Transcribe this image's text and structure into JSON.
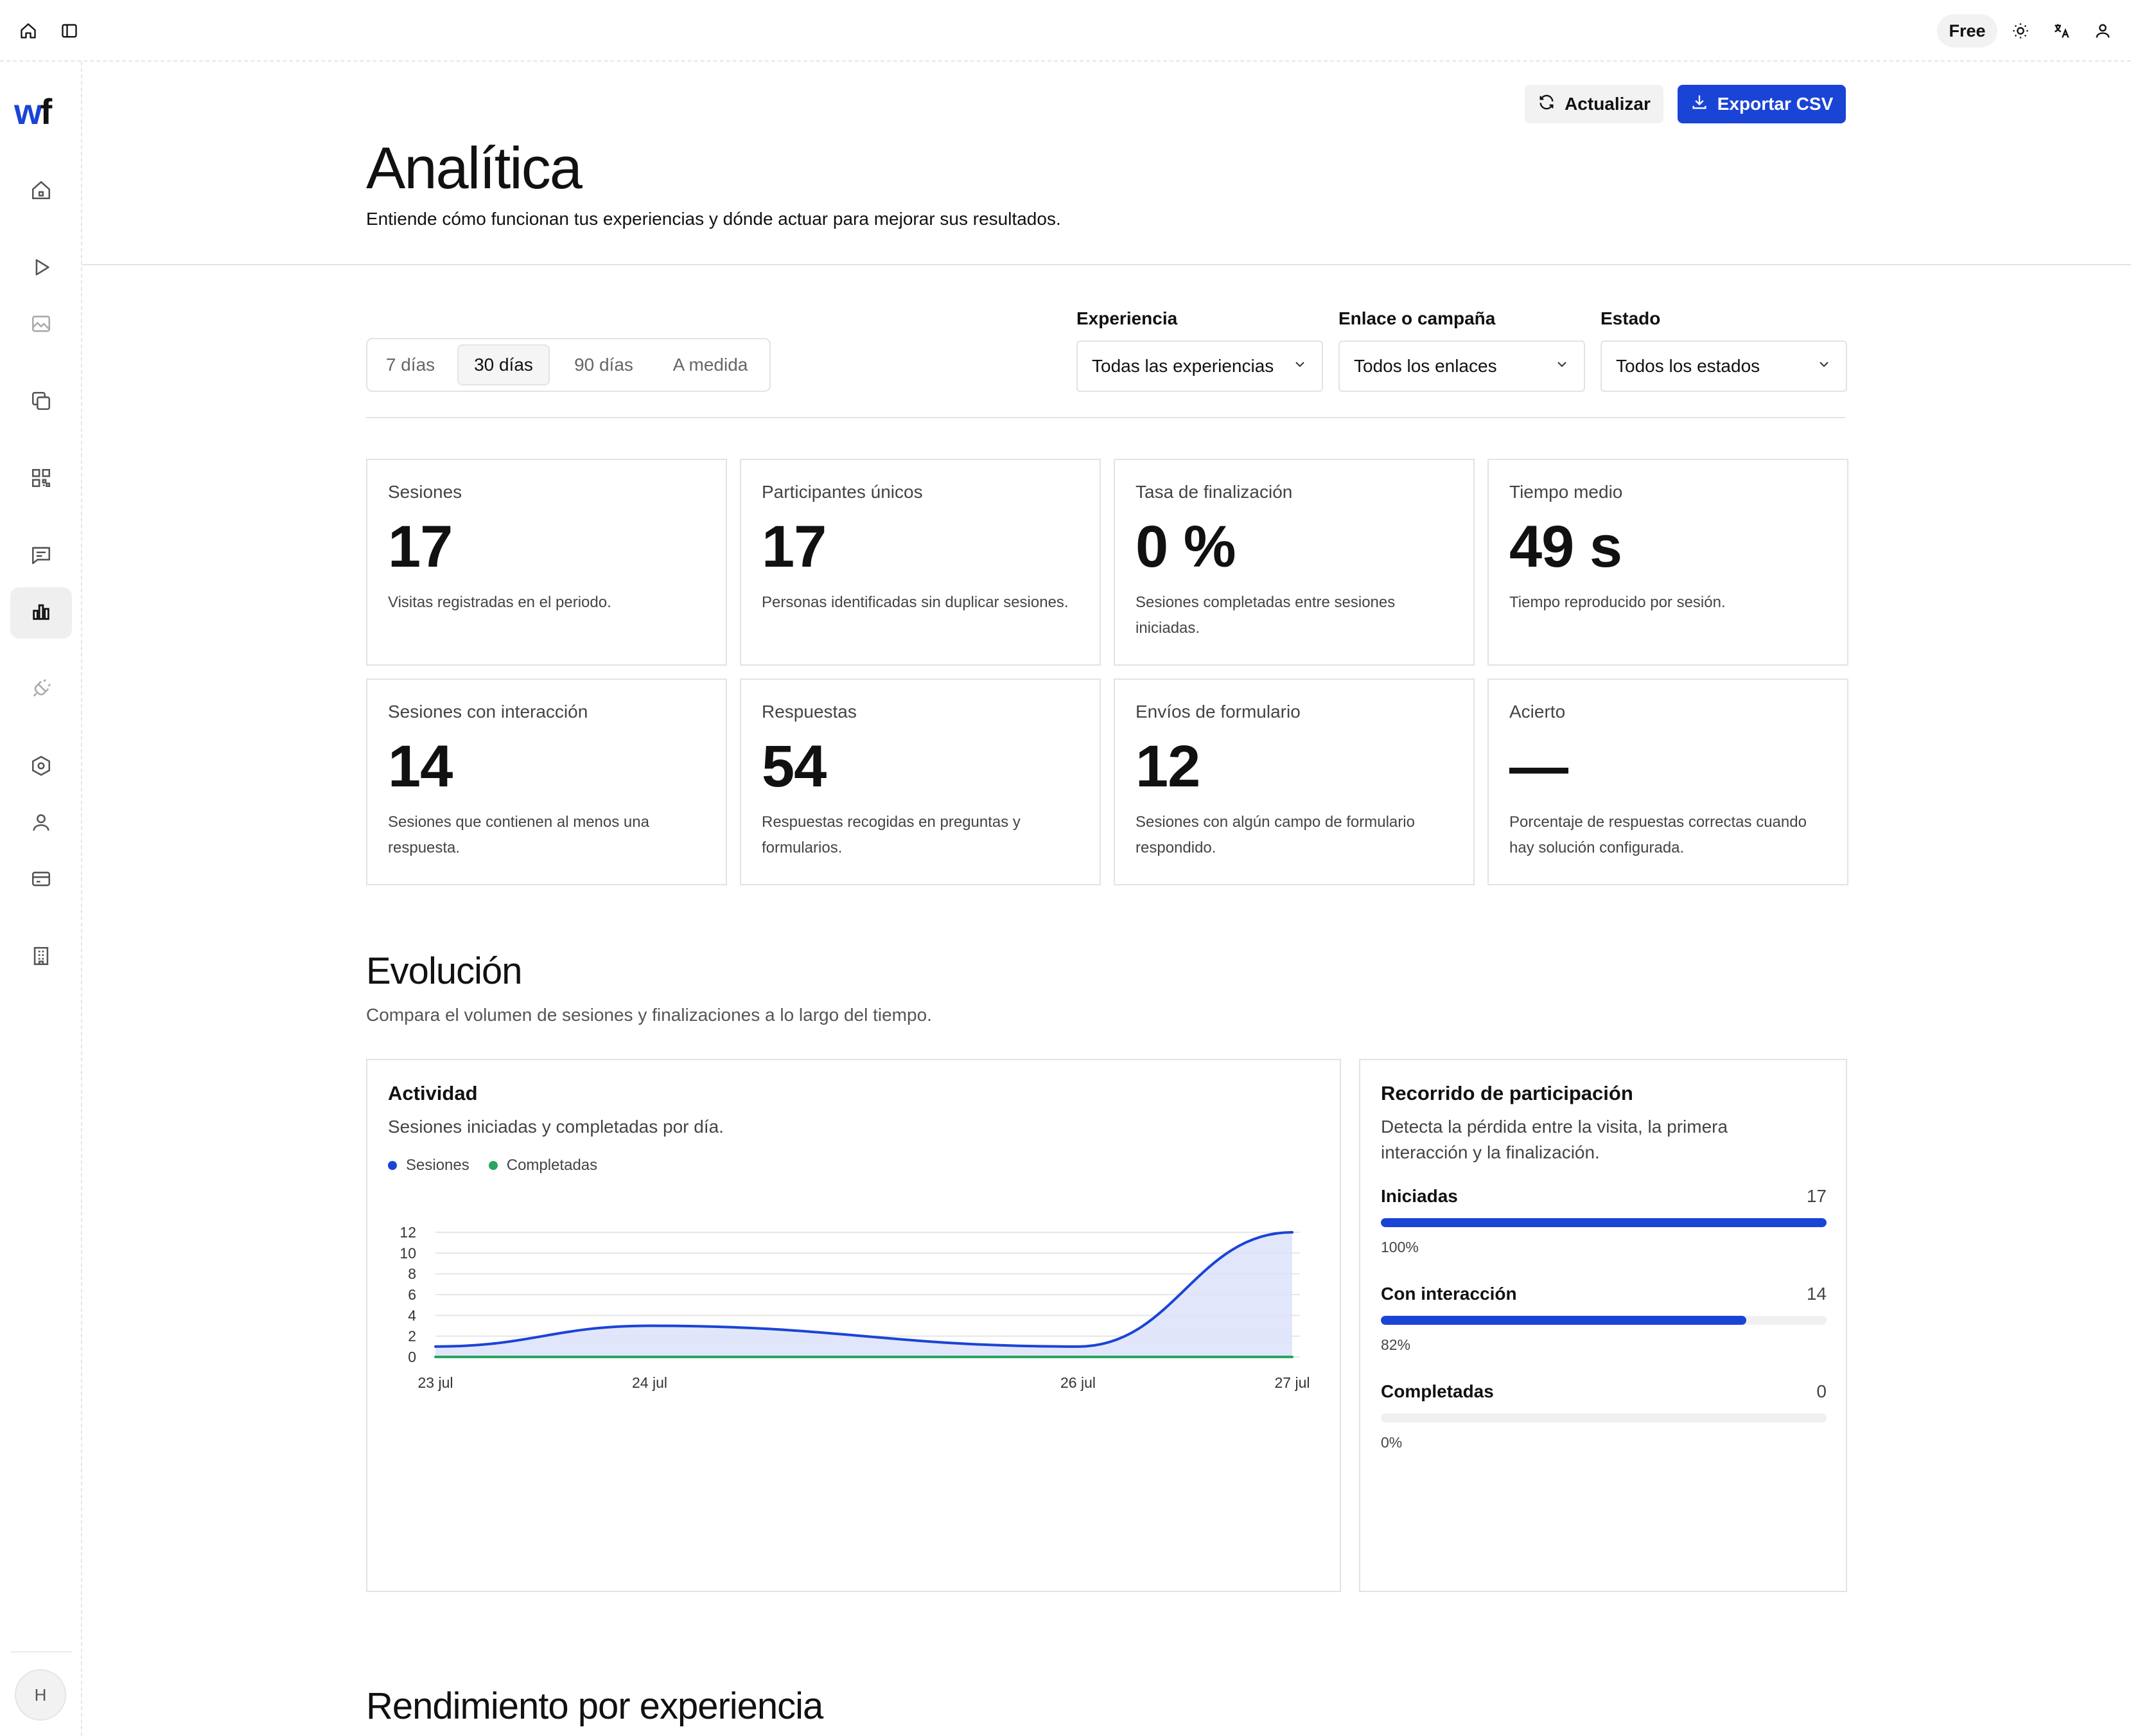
{
  "topbar": {
    "plan": "Free"
  },
  "sidebar": {
    "logo_w": "w",
    "logo_f": "f",
    "items": [
      {
        "name": "home",
        "icon": "home-icon"
      },
      {
        "name": "play",
        "icon": "play-icon"
      },
      {
        "name": "media",
        "icon": "image-icon"
      },
      {
        "name": "library",
        "icon": "copy-icon"
      },
      {
        "name": "qr",
        "icon": "qr-icon"
      },
      {
        "name": "messages",
        "icon": "message-icon"
      },
      {
        "name": "analytics",
        "icon": "chart-icon",
        "active": true
      },
      {
        "name": "integrations",
        "icon": "plug-icon"
      },
      {
        "name": "settings",
        "icon": "hexagon-icon"
      },
      {
        "name": "users",
        "icon": "user-icon"
      },
      {
        "name": "billing",
        "icon": "card-icon"
      },
      {
        "name": "organization",
        "icon": "building-icon"
      }
    ],
    "avatar_initial": "H"
  },
  "actions": {
    "refresh_label": "Actualizar",
    "export_label": "Exportar CSV"
  },
  "header": {
    "title": "Analítica",
    "subtitle": "Entiende cómo funcionan tus experiencias y dónde actuar para mejorar sus resultados."
  },
  "periods": {
    "options": [
      "7 días",
      "30 días",
      "90 días",
      "A medida"
    ],
    "selected": "30 días"
  },
  "filters": {
    "experience": {
      "label": "Experiencia",
      "value": "Todas las experiencias"
    },
    "link": {
      "label": "Enlace o campaña",
      "value": "Todos los enlaces"
    },
    "status": {
      "label": "Estado",
      "value": "Todos los estados"
    }
  },
  "kpis": [
    {
      "label": "Sesiones",
      "value": "17",
      "desc": "Visitas registradas en el periodo."
    },
    {
      "label": "Participantes únicos",
      "value": "17",
      "desc": "Personas identificadas sin duplicar sesiones."
    },
    {
      "label": "Tasa de finalización",
      "value": "0 %",
      "desc": "Sesiones completadas entre sesiones iniciadas."
    },
    {
      "label": "Tiempo medio",
      "value": "49 s",
      "desc": "Tiempo reproducido por sesión."
    },
    {
      "label": "Sesiones con interacción",
      "value": "14",
      "desc": "Sesiones que contienen al menos una respuesta."
    },
    {
      "label": "Respuestas",
      "value": "54",
      "desc": "Respuestas recogidas en preguntas y formularios."
    },
    {
      "label": "Envíos de formulario",
      "value": "12",
      "desc": "Sesiones con algún campo de formulario respondido."
    },
    {
      "label": "Acierto",
      "value": "—",
      "desc": "Porcentaje de respuestas correctas cuando hay solución configurada."
    }
  ],
  "evolution": {
    "title": "Evolución",
    "subtitle": "Compara el volumen de sesiones y finalizaciones a lo largo del tiempo."
  },
  "activity": {
    "title": "Actividad",
    "subtitle": "Sesiones iniciadas y completadas por día."
  },
  "chart_data": {
    "type": "area",
    "x": [
      "2024-07-23",
      "2024-07-24",
      "2024-07-26",
      "2024-07-27"
    ],
    "x_tick_labels": [
      "23 jul",
      "24 jul",
      "26 jul",
      "27 jul"
    ],
    "series": [
      {
        "name": "Sesiones",
        "color": "#1a44d6",
        "values": [
          1,
          3,
          1,
          12
        ]
      },
      {
        "name": "Completadas",
        "color": "#2aa55f",
        "values": [
          0,
          0,
          0,
          0
        ]
      }
    ],
    "ylim": [
      0,
      12
    ],
    "y_ticks": [
      0,
      2,
      4,
      6,
      8,
      10,
      12
    ],
    "grid": true,
    "legend": "top-left"
  },
  "funnel": {
    "title": "Recorrido de participación",
    "subtitle": "Detecta la pérdida entre la visita, la primera interacción y la finalización.",
    "steps": [
      {
        "label": "Iniciadas",
        "count": "17",
        "fraction": 1.0,
        "pct": "100%"
      },
      {
        "label": "Con interacción",
        "count": "14",
        "fraction": 0.82,
        "pct": "82%"
      },
      {
        "label": "Completadas",
        "count": "0",
        "fraction": 0,
        "pct": "0%"
      }
    ]
  },
  "performance": {
    "title": "Rendimiento por experiencia"
  },
  "colors": {
    "accent": "#1a44d6",
    "success": "#2aa55f",
    "border": "#e3e3e3",
    "area_fill": "#dde2fa"
  }
}
